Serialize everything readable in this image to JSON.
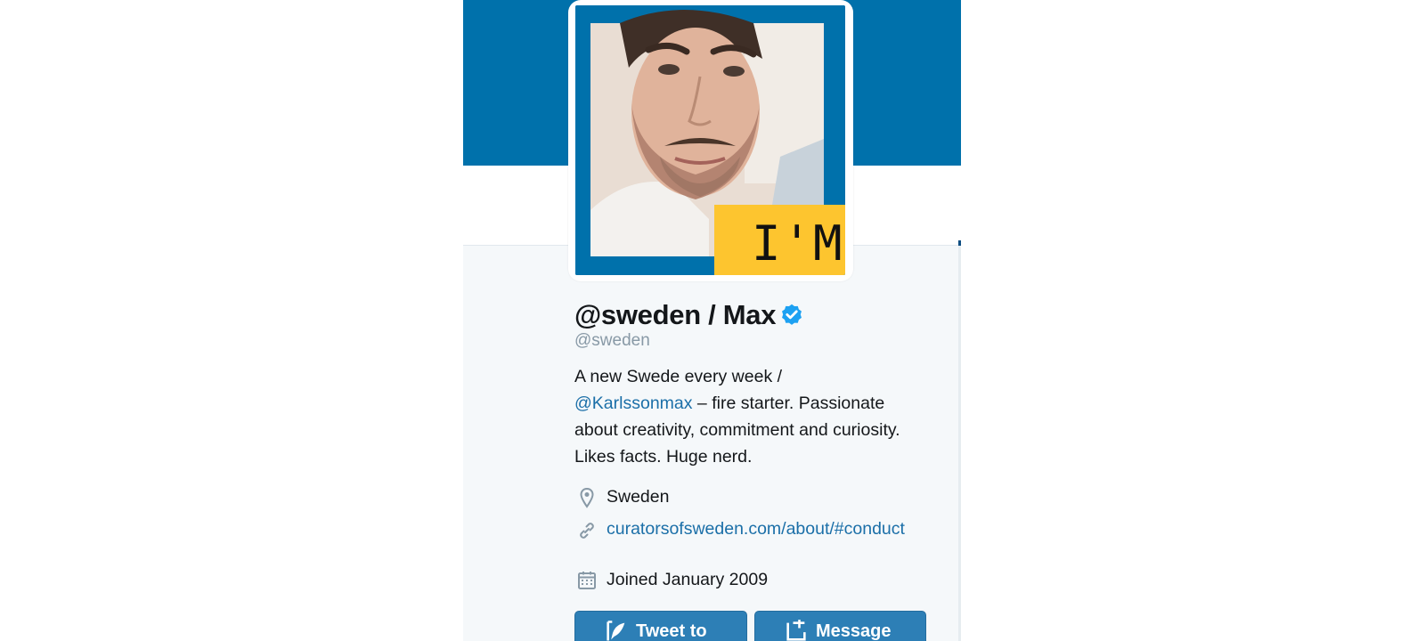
{
  "colors": {
    "banner": "#0071ab",
    "accent_yellow": "#fdc52f",
    "link": "#1b6fa8",
    "verified": "#1da1f2",
    "button": "#2d7fb6"
  },
  "profile": {
    "display_name": "@sweden / Max",
    "verified_icon": "verified-badge-icon",
    "handle": "@sweden",
    "avatar_badge_text": "I'M",
    "bio": {
      "line_start": "A new Swede every week /",
      "mention": "@Karlssonmax",
      "line_rest": " – fire starter. Passionate about creativity, commitment and curiosity. Likes facts. Huge nerd."
    },
    "location_icon": "location-pin-icon",
    "location": "Sweden",
    "website_icon": "link-icon",
    "website": "curatorsofsweden.com/about/#conduct",
    "joined_icon": "calendar-icon",
    "joined": "Joined January 2009"
  },
  "actions": {
    "tweet_to_label": "Tweet to",
    "tweet_to_icon": "quill-icon",
    "message_label": "Message",
    "message_icon": "message-icon"
  }
}
